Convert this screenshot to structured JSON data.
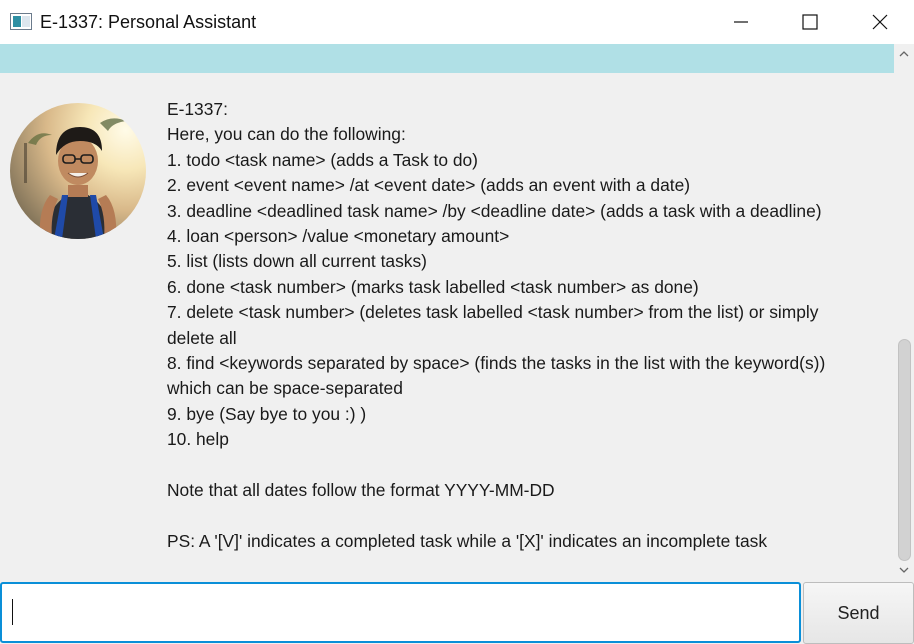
{
  "window": {
    "title": "E-1337: Personal Assistant",
    "minimize_icon": "minimize-icon",
    "maximize_icon": "maximize-icon",
    "close_icon": "close-icon"
  },
  "chat": {
    "lines": [
      "E-1337:",
      "Here, you can do the following:",
      "1. todo <task name> (adds a Task to do)",
      "2. event <event name> /at <event date> (adds an event with a date)",
      "3. deadline <deadlined task name> /by <deadline date> (adds a task with a deadline)",
      "4. loan <person> /value <monetary amount>",
      "5. list (lists down all current tasks)",
      "6. done <task number> (marks task labelled <task number> as done)",
      "7. delete <task number> (deletes task labelled <task number> from the list) or simply",
      "delete all",
      "8. find <keywords separated by space> (finds the tasks in the list with the keyword(s))",
      "which can be space-separated",
      "9. bye (Say bye to you :) )",
      "10. help",
      "",
      "Note that all dates follow the format YYYY-MM-DD",
      "",
      "PS: A '[V]' indicates a completed task while a '[X]' indicates an incomplete task"
    ]
  },
  "input": {
    "value": "",
    "placeholder": ""
  },
  "send_button": {
    "label": "Send"
  },
  "colors": {
    "accent_strip": "#b0e0e6",
    "input_focus": "#0a8fd8",
    "chat_background": "#f0f0f0"
  }
}
